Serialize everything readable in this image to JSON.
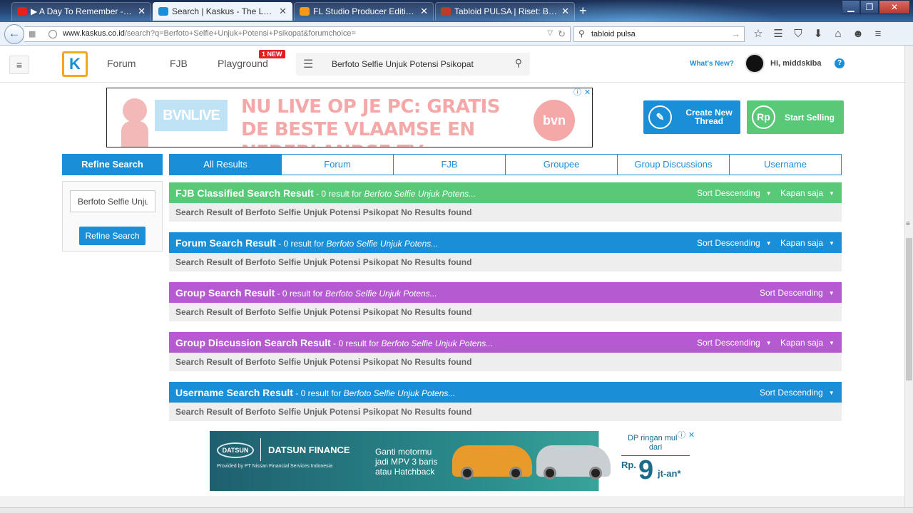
{
  "browser": {
    "tabs": [
      {
        "title": "▶ A Day To Remember - I'...",
        "favicon": "youtube-icon",
        "color": "#e62117"
      },
      {
        "title": "Search | Kaskus - The Large...",
        "favicon": "kaskus-icon",
        "color": "#1b8ed8"
      },
      {
        "title": "FL Studio Producer Edition ...",
        "favicon": "fl-studio-icon",
        "color": "#f39c12"
      },
      {
        "title": "Tabloid PULSA | Riset: Berf...",
        "favicon": "pulsa-icon",
        "color": "#c0392b"
      }
    ],
    "new_tab": "+",
    "url_host": "www.kaskus.co.id",
    "url_path": "/search?q=Berfoto+Selfie+Unjuk+Potensi+Psikopat&forumchoice=",
    "search_query": "tabloid pulsa"
  },
  "header": {
    "logo_text": "K",
    "nav": {
      "forum": "Forum",
      "fjb": "FJB",
      "playground": "Playground"
    },
    "new_badge": "1 NEW",
    "search_value": "Berfoto Selfie Unjuk Potensi Psikopat",
    "whats_new": "What's New?",
    "greeting": "Hi, middskiba",
    "help": "?"
  },
  "ad_top": {
    "bvn_live": "BVNLIVE",
    "headline": "NU LIVE OP JE PC: GRATIS DE BESTE VLAAMSE EN NEDERLANDSE TV",
    "bvn": "bvn"
  },
  "actions": {
    "create_thread": "Create New Thread",
    "create_thread_icon": "pencil-icon",
    "start_selling": "Start Selling",
    "start_selling_icon": "Rp"
  },
  "refine": {
    "header": "Refine Search",
    "input_value": "Berfoto Selfie Unjuk Potensi Psikopat",
    "button": "Refine Search"
  },
  "result_tabs": [
    "All Results",
    "Forum",
    "FJB",
    "Groupee",
    "Group Discussions",
    "Username"
  ],
  "sections": [
    {
      "title": "FJB Classified Search Result",
      "count": " - 0 result for ",
      "query": "Berfoto Selfie Unjuk Potens...",
      "sort": "Sort Descending",
      "time": "Kapan saja",
      "body": "Search Result of Berfoto Selfie Unjuk Potensi Psikopat No Results found",
      "color": "#58c977"
    },
    {
      "title": "Forum Search Result",
      "count": " - 0 result for ",
      "query": "Berfoto Selfie Unjuk Potens...",
      "sort": "Sort Descending",
      "time": "Kapan saja",
      "body": "Search Result of Berfoto Selfie Unjuk Potensi Psikopat No Results found",
      "color": "#1b8ed8"
    },
    {
      "title": "Group Search Result",
      "count": " - 0 result for ",
      "query": "Berfoto Selfie Unjuk Potens...",
      "sort": "Sort Descending",
      "body": "Search Result of Berfoto Selfie Unjuk Potensi Psikopat No Results found",
      "color": "#b55ad0"
    },
    {
      "title": "Group Discussion Search Result",
      "count": " - 0 result for ",
      "query": "Berfoto Selfie Unjuk Potens...",
      "sort": "Sort Descending",
      "time": "Kapan saja",
      "body": "Search Result of Berfoto Selfie Unjuk Potensi Psikopat No Results found",
      "color": "#b55ad0"
    },
    {
      "title": "Username Search Result",
      "count": " - 0 result for ",
      "query": "Berfoto Selfie Unjuk Potens...",
      "sort": "Sort Descending",
      "body": "Search Result of Berfoto Selfie Unjuk Potensi Psikopat No Results found",
      "color": "#1b8ed8"
    }
  ],
  "ad_bottom": {
    "logo": "DATSUN",
    "brand": "DATSUN FINANCE",
    "provided_by": "Provided by PT Nissan Financial Services Indonesia",
    "tagline": "Ganti motormu jadi MPV 3 baris atau Hatchback",
    "dp": "DP ringan mulai dari",
    "rp": "Rp.",
    "amount": "9",
    "unit": "jt-an*"
  }
}
